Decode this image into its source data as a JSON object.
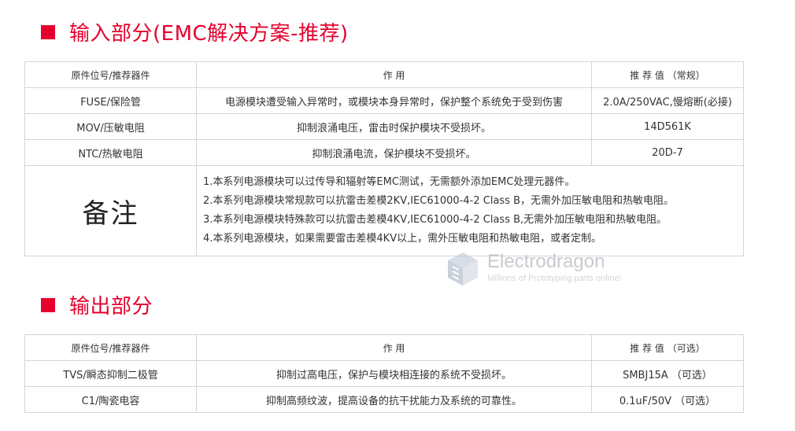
{
  "input_section": {
    "title": "输入部分(EMC解决方案-推荐)",
    "headers": [
      "原件位号/推荐器件",
      "作 用",
      "推 荐 值 （常规）"
    ],
    "rows": [
      {
        "part": "FUSE/保险管",
        "function": "电源模块遭受输入异常时，或模块本身异常时，保护整个系统免于受到伤害",
        "value": "2.0A/250VAC,慢熔断(必接)"
      },
      {
        "part": "MOV/压敏电阻",
        "function": "抑制浪涌电压，雷击时保护模块不受损坏。",
        "value": "14D561K"
      },
      {
        "part": "NTC/热敏电阻",
        "function": "抑制浪涌电流，保护模块不受损坏。",
        "value": "20D-7"
      }
    ],
    "notes_label": "备注",
    "notes": [
      "1.本系列电源模块可以过传导和辐射等EMC测试，无需额外添加EMC处理元器件。",
      "2.本系列电源模块常规款可以抗雷击差模2KV,IEC61000-4-2 Class B，无需外加压敏电阻和热敏电阻。",
      "3.本系列电源模块特殊款可以抗雷击差模4KV,IEC61000-4-2 Class B,无需外加压敏电阻和热敏电阻。",
      "4.本系列电源模块，如果需要雷击差模4KV以上，需外压敏电阻和热敏电阻，或者定制。"
    ]
  },
  "output_section": {
    "title": "输出部分",
    "headers": [
      "原件位号/推荐器件",
      "作 用",
      "推 荐 值 （可选）"
    ],
    "rows": [
      {
        "part": "TVS/瞬态抑制二极管",
        "function": "抑制过高电压，保护与模块相连接的系统不受损坏。",
        "value": "SMBJ15A （可选）"
      },
      {
        "part": "C1/陶瓷电容",
        "function": "抑制高频纹波，提高设备的抗干扰能力及系统的可靠性。",
        "value": "0.1uF/50V （可选）"
      }
    ]
  },
  "watermark": {
    "brand": "Electrodragon",
    "tagline": "Millions of Prototyping parts online!"
  },
  "colors": {
    "accent": "#e6002d",
    "border": "#d5d5d5",
    "text": "#333333"
  }
}
